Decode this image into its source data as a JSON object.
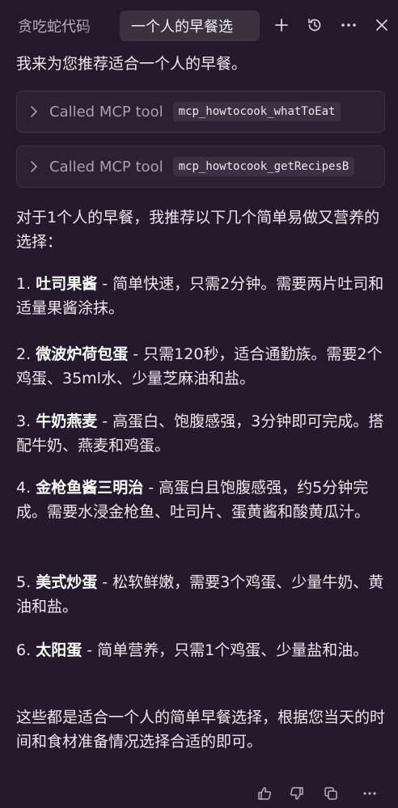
{
  "tabs": [
    {
      "label": "贪吃蛇代码",
      "active": false
    },
    {
      "label": "一个人的早餐选",
      "active": true
    }
  ],
  "toolbar_icons": [
    "plus-icon",
    "history-icon",
    "more-icon",
    "close-icon"
  ],
  "intro": "我来为您推荐适合一个人的早餐。",
  "tool_calls": [
    {
      "called_label": "Called MCP tool",
      "tool_name": "mcp_howtocook_whatToEat"
    },
    {
      "called_label": "Called MCP tool",
      "tool_name": "mcp_howtocook_getRecipesB"
    }
  ],
  "summary_intro": "对于1个人的早餐，我推荐以下几个简单易做又营养的选择：",
  "recommendations": [
    {
      "num": "1.",
      "title": "吐司果酱",
      "text": " - 简单快速，只需2分钟。需要两片吐司和适量果酱涂抹。"
    },
    {
      "num": "2.",
      "title": "微波炉荷包蛋",
      "text": " - 只需120秒，适合通勤族。需要2个鸡蛋、35ml水、少量芝麻油和盐。"
    },
    {
      "num": "3.",
      "title": "牛奶燕麦",
      "text": " - 高蛋白、饱腹感强，3分钟即可完成。搭配牛奶、燕麦和鸡蛋。"
    },
    {
      "num": "4.",
      "title": "金枪鱼酱三明治",
      "text": " - 高蛋白且饱腹感强，约5分钟完成。需要水浸金枪鱼、吐司片、蛋黄酱和酸黄瓜汁。"
    },
    {
      "num": "5.",
      "title": "美式炒蛋",
      "text": " - 松软鲜嫩，需要3个鸡蛋、少量牛奶、黄油和盐。"
    },
    {
      "num": "6.",
      "title": "太阳蛋",
      "text": " - 简单营养，只需1个鸡蛋、少量盐和油。"
    }
  ],
  "closing": "这些都是适合一个人的简单早餐选择，根据您当天的时间和食材准备情况选择合适的即可。",
  "footer_icons": [
    "thumbs-up-icon",
    "thumbs-down-icon",
    "copy-icon",
    "more-icon"
  ]
}
